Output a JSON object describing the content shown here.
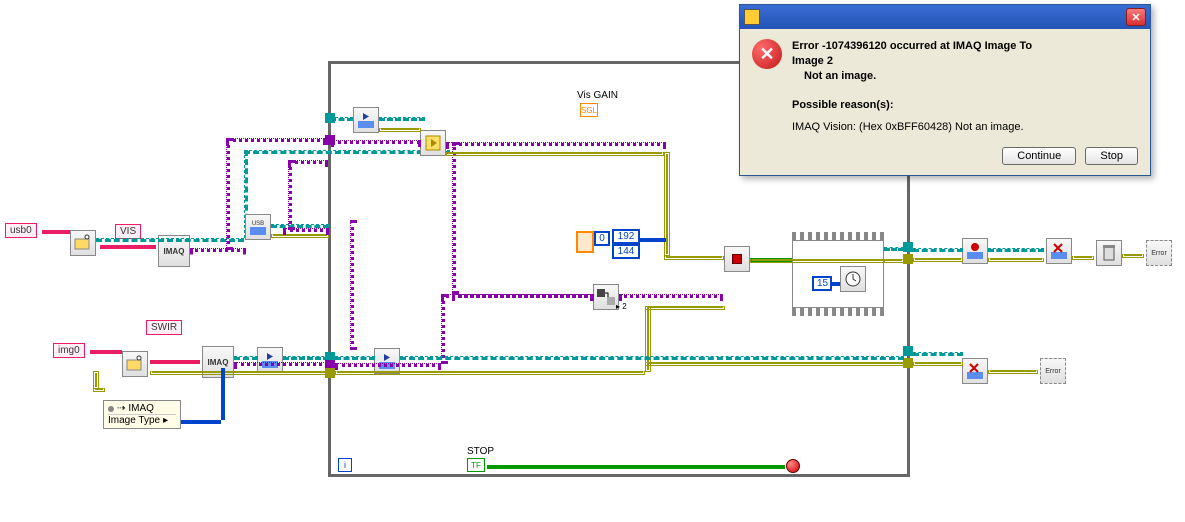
{
  "controls": {
    "usb0": "usb0",
    "vis": "VIS",
    "img0": "img0",
    "swir": "SWIR",
    "vis_gain_label": "Vis GAIN",
    "vis_gain_term": "SGL",
    "stop_label": "STOP",
    "stop_term": "TF"
  },
  "constants": {
    "cluster_index": "0",
    "res_x": "192",
    "res_y": "144",
    "wait_ms": "15"
  },
  "property": {
    "ref": "IMAQ",
    "prop": "Image Type"
  },
  "icons": {
    "imaq": "IMAQ",
    "usb": "USB",
    "play": "▶",
    "grab": "▶",
    "close": "✕",
    "stop": "■",
    "wait": "⏱",
    "dispose": "🗑",
    "error": "?!",
    "convert": "⇄",
    "rec": "●"
  },
  "indicators": {
    "error1": "Error",
    "error2": "Error"
  },
  "loop": {
    "iter": "i"
  },
  "dialog": {
    "title": " ",
    "line1": "Error -1074396120 occurred at IMAQ Image To",
    "line2": "Image 2",
    "line3": "Not an image.",
    "reasons_heading": "Possible reason(s):",
    "reason": "IMAQ Vision:  (Hex 0xBFF60428) Not an image.",
    "continue": "Continue",
    "stop": "Stop"
  }
}
